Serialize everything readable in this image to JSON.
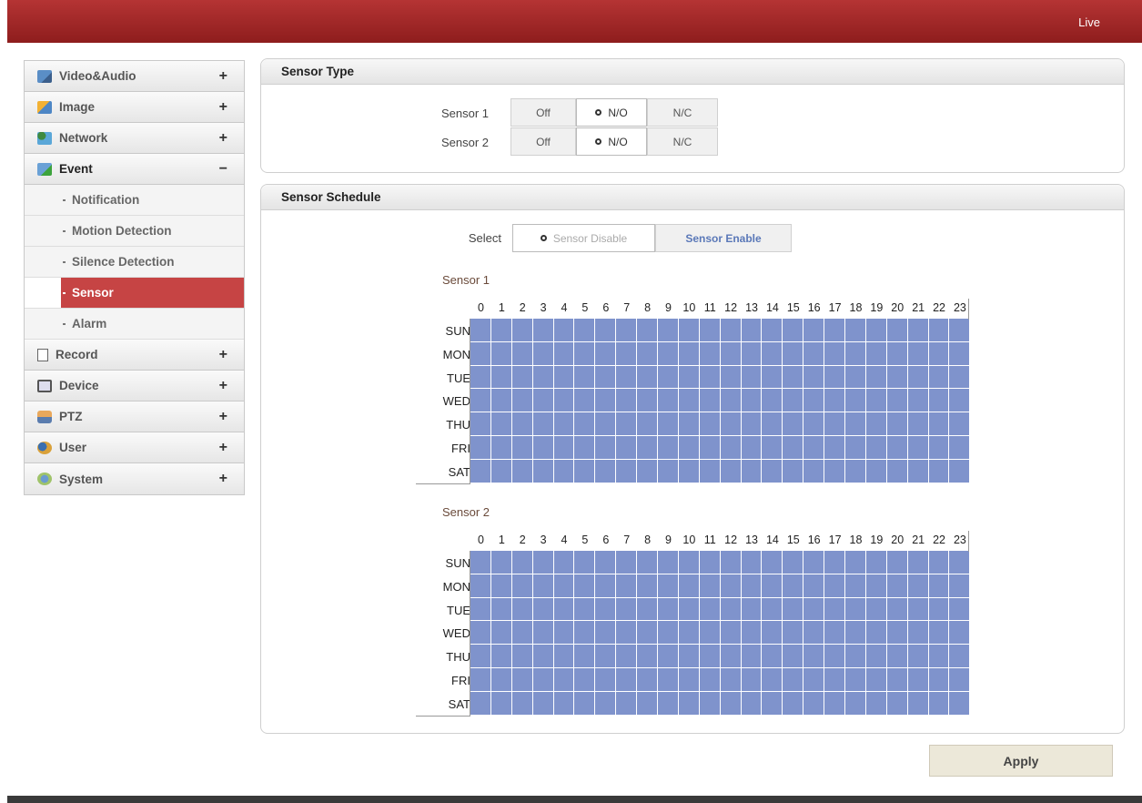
{
  "header": {
    "live_label": "Live"
  },
  "sidebar": {
    "items": [
      {
        "label": "Video&Audio",
        "icon": "video-icon",
        "toggle": "+"
      },
      {
        "label": "Image",
        "icon": "image-icon",
        "toggle": "+"
      },
      {
        "label": "Network",
        "icon": "network-icon",
        "toggle": "+"
      },
      {
        "label": "Event",
        "icon": "event-icon",
        "toggle": "−"
      },
      {
        "label": "Record",
        "icon": "record-icon",
        "toggle": "+"
      },
      {
        "label": "Device",
        "icon": "device-icon",
        "toggle": "+"
      },
      {
        "label": "PTZ",
        "icon": "ptz-icon",
        "toggle": "+"
      },
      {
        "label": "User",
        "icon": "user-icon",
        "toggle": "+"
      },
      {
        "label": "System",
        "icon": "system-icon",
        "toggle": "+"
      }
    ],
    "event_sub": [
      {
        "label": "Notification"
      },
      {
        "label": "Motion Detection"
      },
      {
        "label": "Silence Detection"
      },
      {
        "label": "Sensor",
        "active": true
      },
      {
        "label": "Alarm"
      }
    ]
  },
  "sensor_type": {
    "title": "Sensor Type",
    "rows": [
      {
        "label": "Sensor 1",
        "options": [
          "Off",
          "N/O",
          "N/C"
        ],
        "selected": "N/O"
      },
      {
        "label": "Sensor 2",
        "options": [
          "Off",
          "N/O",
          "N/C"
        ],
        "selected": "N/O"
      }
    ]
  },
  "sensor_schedule": {
    "title": "Sensor Schedule",
    "select_label": "Select",
    "options": [
      "Sensor Disable",
      "Sensor Enable"
    ],
    "selected": "Sensor Disable",
    "hours": [
      "0",
      "1",
      "2",
      "3",
      "4",
      "5",
      "6",
      "7",
      "8",
      "9",
      "10",
      "11",
      "12",
      "13",
      "14",
      "15",
      "16",
      "17",
      "18",
      "19",
      "20",
      "21",
      "22",
      "23"
    ],
    "days": [
      "SUN",
      "MON",
      "TUE",
      "WED",
      "THU",
      "FRI",
      "SAT"
    ],
    "sensors": [
      {
        "title": "Sensor 1"
      },
      {
        "title": "Sensor 2"
      }
    ],
    "cell_color": "#7f93cc"
  },
  "apply_label": "Apply",
  "colors": {
    "accent": "#a82828",
    "active_item": "#c64444"
  }
}
